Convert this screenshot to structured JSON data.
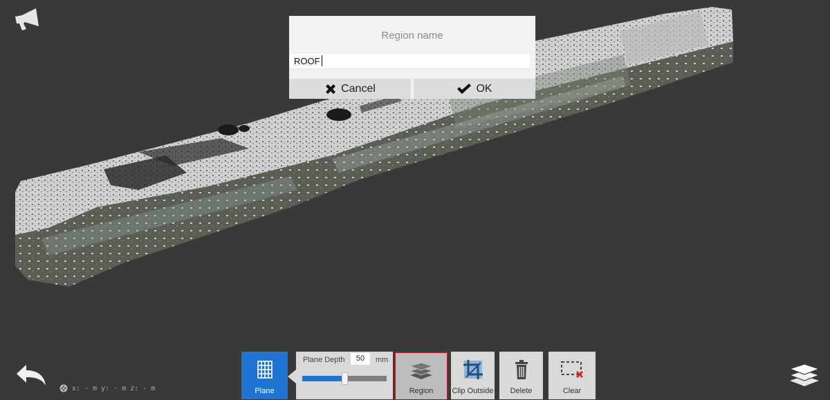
{
  "dialog": {
    "title": "Region name",
    "input_value": "ROOF",
    "cancel_label": "Cancel",
    "ok_label": "OK"
  },
  "toolbar": {
    "plane_label": "Plane",
    "plane_depth_label": "Plane Depth",
    "plane_depth_value": "50",
    "plane_depth_unit": "mm",
    "plane_depth_fraction": 0.5,
    "region_label": "Region",
    "clip_outside_label": "Clip Outside",
    "delete_label": "Delete",
    "clear_label": "Clear",
    "active_tool": "Plane",
    "highlighted_tool": "Region"
  },
  "coordinates": {
    "x_label": "x:",
    "x_value": "-",
    "x_unit": "m",
    "y_label": "y:",
    "y_value": "-",
    "y_unit": "m",
    "z_label": "z:",
    "z_value": "-",
    "z_unit": "m"
  },
  "icons": {
    "announce": "megaphone-icon",
    "back": "back-arrow-icon",
    "layers": "layers-icon",
    "plane": "grid-plane-icon",
    "region": "stacked-layers-icon",
    "clip": "crop-icon",
    "delete": "trash-icon",
    "clear": "dashed-box-x-icon"
  },
  "colors": {
    "background": "#393939",
    "accent": "#1e74d0",
    "highlight_border": "#b2191b",
    "toolbar": "#d9d9d9",
    "dialog": "#f2f2f2"
  }
}
